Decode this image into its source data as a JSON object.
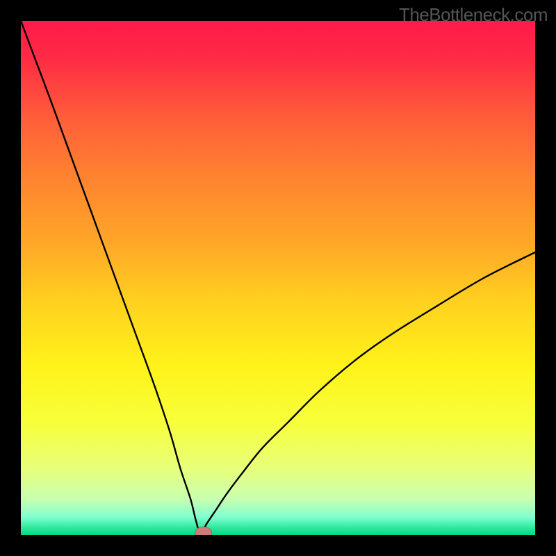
{
  "watermark_text": "TheBottleneck.com",
  "colors": {
    "black": "#000000",
    "gradient_stops": [
      {
        "offset": 0.0,
        "color": "#ff1a4b"
      },
      {
        "offset": 0.07,
        "color": "#ff2a45"
      },
      {
        "offset": 0.18,
        "color": "#ff5a3a"
      },
      {
        "offset": 0.3,
        "color": "#ff8230"
      },
      {
        "offset": 0.43,
        "color": "#ffa628"
      },
      {
        "offset": 0.55,
        "color": "#ffd21f"
      },
      {
        "offset": 0.67,
        "color": "#fff21a"
      },
      {
        "offset": 0.78,
        "color": "#f7ff3a"
      },
      {
        "offset": 0.87,
        "color": "#e8ff7a"
      },
      {
        "offset": 0.93,
        "color": "#c8ffb0"
      },
      {
        "offset": 0.965,
        "color": "#80ffd0"
      },
      {
        "offset": 0.985,
        "color": "#30e9a0"
      },
      {
        "offset": 1.0,
        "color": "#00d880"
      }
    ],
    "curve": "#000000",
    "marker_fill": "#cf7a7a",
    "marker_stroke": "#b96060"
  },
  "chart_data": {
    "type": "line",
    "title": "",
    "xlabel": "",
    "ylabel": "",
    "xlim": [
      0,
      100
    ],
    "ylim": [
      0,
      100
    ],
    "grid": false,
    "legend": false,
    "notes": "Bottleneck-style V-curve. y ≈ 0 at x ≈ 35 (optimal point). Steep near-linear rise toward y≈100 as x→0; convex rise toward y≈55 as x→100. Marker at the minimum.",
    "series": [
      {
        "name": "bottleneck_curve",
        "x": [
          0,
          3,
          6,
          10,
          14,
          18,
          22,
          26,
          29,
          31,
          33,
          34,
          35,
          36,
          38,
          40,
          43,
          47,
          52,
          58,
          65,
          72,
          80,
          90,
          100
        ],
        "y": [
          100,
          92,
          84,
          73,
          62,
          51,
          40,
          29,
          20,
          13,
          7,
          3,
          0,
          2,
          5,
          8,
          12,
          17,
          22,
          28,
          34,
          39,
          44,
          50,
          55
        ]
      }
    ],
    "marker": {
      "x": 35.5,
      "y": 0.5,
      "rx": 1.6,
      "ry": 1.1
    }
  }
}
